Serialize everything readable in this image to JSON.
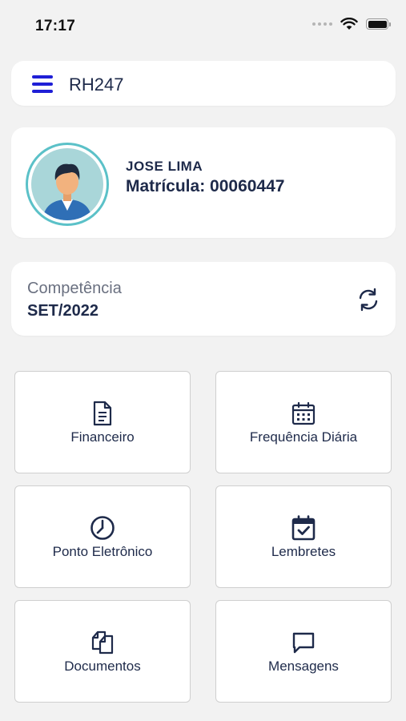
{
  "status_bar": {
    "time": "17:17"
  },
  "header": {
    "title": "RH247"
  },
  "profile": {
    "name": "JOSE LIMA",
    "registration_label": "Matrícula:",
    "registration_number": "00060447"
  },
  "period": {
    "label": "Competência",
    "value": "SET/2022"
  },
  "tiles": [
    {
      "label": "Financeiro",
      "icon": "document-icon"
    },
    {
      "label": "Frequência Diária",
      "icon": "calendar-icon"
    },
    {
      "label": "Ponto Eletrônico",
      "icon": "clock-icon"
    },
    {
      "label": "Lembretes",
      "icon": "calendar-check-icon"
    },
    {
      "label": "Documentos",
      "icon": "copy-documents-icon"
    },
    {
      "label": "Mensagens",
      "icon": "chat-icon"
    }
  ],
  "colors": {
    "accent": "#1f1fd6",
    "text": "#1e2a4a",
    "avatar_ring": "#5bc1c8",
    "background": "#f2f2f2"
  }
}
